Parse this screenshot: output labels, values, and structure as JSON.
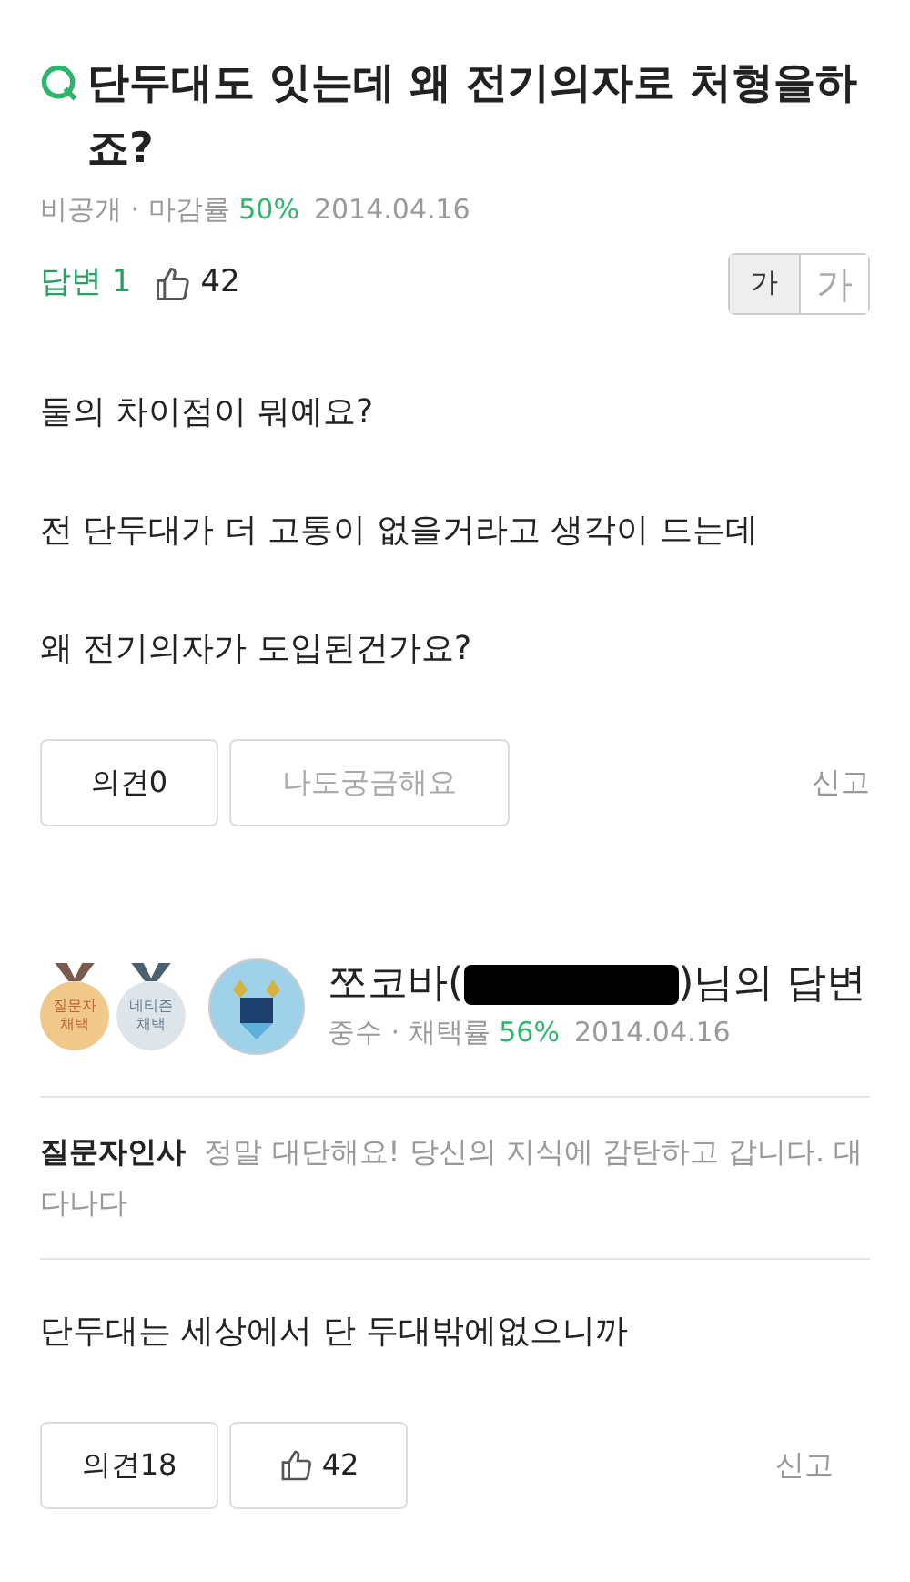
{
  "question": {
    "title": "단두대도 잇는데 왜 전기의자로 처형을하죠?",
    "visibility": "비공개",
    "separator": "·",
    "close_rate_label": "마감률",
    "close_rate": "50%",
    "date": "2014.04.16",
    "answers": "답변 1",
    "likes": "42",
    "font_sizes": [
      {
        "label": "가",
        "selected": true
      },
      {
        "label": "가",
        "selected": false
      }
    ],
    "body": [
      "둘의 차이점이 뭐예요?",
      "전 단두대가 더 고통이 없을거라고 생각이 드는데",
      "왜 전기의자가 도입된건가요?"
    ],
    "opinion_button": "의견0",
    "curious_button": "나도궁금해요",
    "report": "신고"
  },
  "answer": {
    "medals": [
      {
        "label": "질문자\n채택",
        "color": "#f0c98a"
      },
      {
        "label": "네티즌\n채택",
        "color": "#dde4ea"
      }
    ],
    "author_prefix": "쪼코바(",
    "author_suffix": ")님의 답변",
    "redacted": true,
    "rank": "중수",
    "separator": "·",
    "adopt_rate_label": "채택률",
    "adopt_rate": "56%",
    "date": "2014.04.16",
    "thanks_label": "질문자인사",
    "thanks": "정말 대단해요! 당신의 지식에 감탄하고 갑니다. 대다나다",
    "body": "단두대는 세상에서 단 두대밖에없으니까",
    "opinion_button": "의견18",
    "likes": "42",
    "report": "신고"
  }
}
